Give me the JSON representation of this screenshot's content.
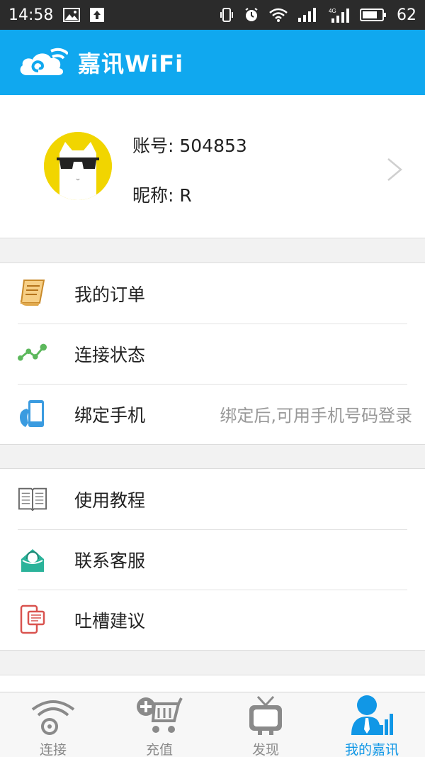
{
  "status_bar": {
    "time": "14:58",
    "battery": "62",
    "network": "4G"
  },
  "header": {
    "title": "嘉讯WiFi"
  },
  "profile": {
    "account": "账号: 504853",
    "nickname": "昵称: R"
  },
  "menu": {
    "group1": [
      {
        "label": "我的订单",
        "icon": "order-icon"
      },
      {
        "label": "连接状态",
        "icon": "connection-status-icon"
      },
      {
        "label": "绑定手机",
        "icon": "bind-phone-icon",
        "hint": "绑定后,可用手机号码登录"
      }
    ],
    "group2": [
      {
        "label": "使用教程",
        "icon": "tutorial-book-icon"
      },
      {
        "label": "联系客服",
        "icon": "customer-service-icon"
      },
      {
        "label": "吐槽建议",
        "icon": "feedback-icon"
      }
    ]
  },
  "tabs": [
    {
      "label": "连接",
      "icon": "wifi-tab-icon",
      "active": false
    },
    {
      "label": "充值",
      "icon": "cart-tab-icon",
      "active": false
    },
    {
      "label": "发现",
      "icon": "tv-tab-icon",
      "active": false
    },
    {
      "label": "我的嘉讯",
      "icon": "profile-tab-icon",
      "active": true
    }
  ],
  "colors": {
    "brand_blue": "#10a8ef",
    "active_tab": "#1197e6",
    "status_bar": "#2b2b2b"
  }
}
